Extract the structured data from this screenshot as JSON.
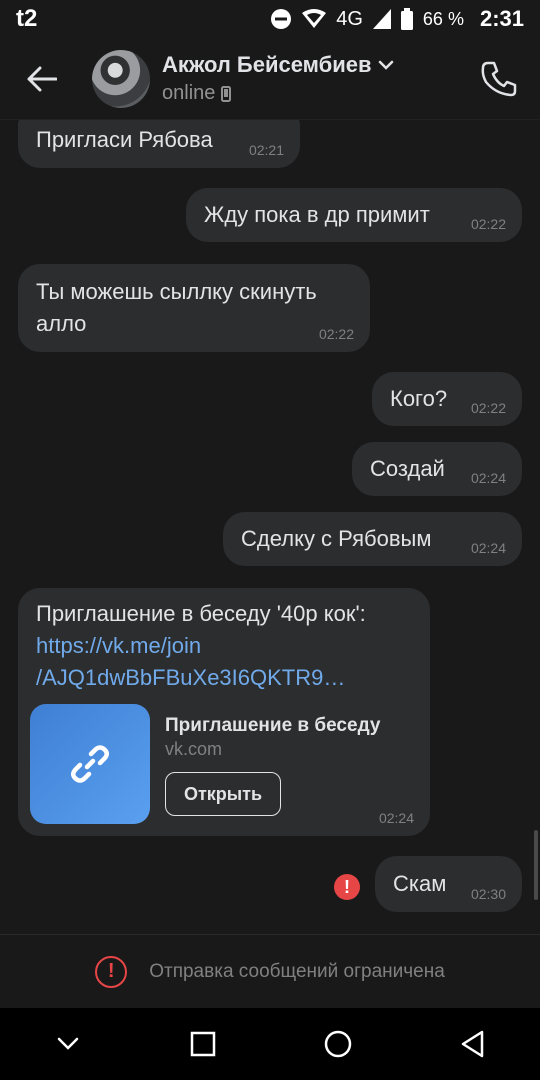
{
  "status_bar": {
    "carrier": "t2",
    "network": "4G",
    "battery": "66 %",
    "time": "2:31"
  },
  "header": {
    "contact_name": "Акжол Бейсембиев",
    "status": "online"
  },
  "messages": [
    {
      "text": "Пригласи Рябова",
      "time": "02:21",
      "direction": "in"
    },
    {
      "text": "Жду пока в др примит",
      "time": "02:22",
      "direction": "out"
    },
    {
      "text": "Ты можешь сыллку скинуть алло",
      "time": "02:22",
      "direction": "in"
    },
    {
      "text": "Кого?",
      "time": "02:22",
      "direction": "out"
    },
    {
      "text": "Создай",
      "time": "02:24",
      "direction": "out"
    },
    {
      "text": "Сделку с Рябовым",
      "time": "02:24",
      "direction": "out"
    },
    {
      "invite_title": "Приглашение в беседу '40р кок':",
      "link_line1": "https://vk.me/join",
      "link_line2": "/AJQ1dwBbFBuXe3I6QKTR9…",
      "attachment_title": "Приглашение в беседу",
      "attachment_domain": "vk.com",
      "open_label": "Открыть",
      "time": "02:24",
      "direction": "in"
    },
    {
      "text": "Скам",
      "time": "02:30",
      "direction": "out",
      "failed": true
    }
  ],
  "restriction": {
    "text": "Отправка сообщений ограничена"
  },
  "colors": {
    "background": "#19191a",
    "bubble": "#2c2d2e",
    "link": "#71aaeb",
    "error": "#e64646"
  }
}
